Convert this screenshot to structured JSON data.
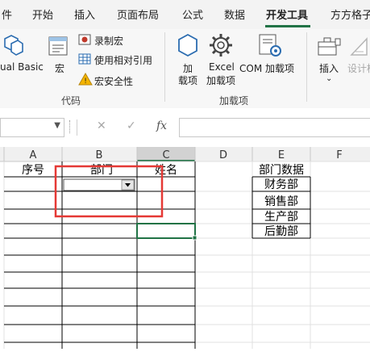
{
  "tabs": [
    "件",
    "开始",
    "插入",
    "页面布局",
    "公式",
    "数据",
    "开发工具",
    "方方格子"
  ],
  "active_tab": "开发工具",
  "ribbon": {
    "visual_basic": "ual Basic",
    "macros": "宏",
    "record_macro": "录制宏",
    "relative_ref": "使用相对引用",
    "macro_security": "宏安全性",
    "addins_line1": "加",
    "addins_line2": "载项",
    "excel_addins_line1": "Excel",
    "excel_addins_line2": "加载项",
    "com_addins": "COM 加载项",
    "insert": "插入",
    "design_mode": "设计模",
    "group_code": "代码",
    "group_addins": "加载项"
  },
  "formula_bar": {
    "cancel": "✕",
    "enter": "✓",
    "fx": "fx"
  },
  "columns": [
    "A",
    "B",
    "C",
    "D",
    "E",
    "F"
  ],
  "cells": {
    "a1": "序号",
    "b1": "部门",
    "c1": "姓名",
    "e_header": "部门数据",
    "e_values": [
      "财务部",
      "销售部",
      "生产部",
      "后勤部"
    ]
  },
  "colors": {
    "accent": "#217346",
    "highlight": "#e53935",
    "grid": "#000000"
  }
}
